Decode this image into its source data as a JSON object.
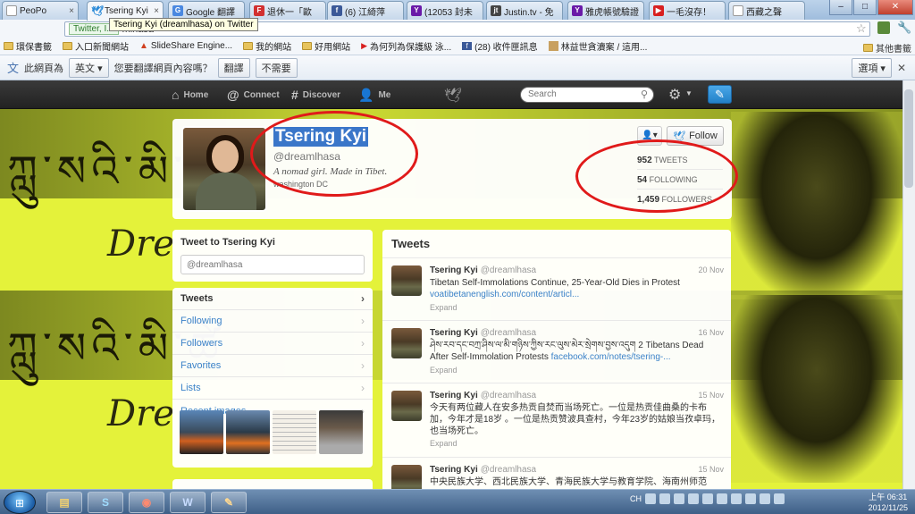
{
  "browser": {
    "tabs": [
      {
        "title": "PeoPo",
        "icon": "document-icon",
        "color": "#ffffff"
      },
      {
        "title": "Tsering Kyi",
        "icon": "twitter-bird-icon",
        "color": "#2a8ad8"
      },
      {
        "title": "Google 翻譯",
        "icon": "google-translate-icon",
        "color": "#4a88e0"
      },
      {
        "title": "退休一「歐",
        "icon": "flipboard-icon",
        "color": "#d23030"
      },
      {
        "title": "(6) 江綺萍",
        "icon": "facebook-icon",
        "color": "#3b5998"
      },
      {
        "title": "(12053 封未",
        "icon": "yahoo-icon",
        "color": "#6a1aa8"
      },
      {
        "title": "Justin.tv - 免",
        "icon": "justintv-icon",
        "color": "#444444"
      },
      {
        "title": "雅虎帳號驗證",
        "icon": "yahoo-icon",
        "color": "#6a1aa8"
      },
      {
        "title": "一毛沒存！",
        "icon": "youtube-icon",
        "color": "#d82020"
      },
      {
        "title": "西藏之聲",
        "icon": "document-icon",
        "color": "#ffffff"
      }
    ],
    "secure_label": "Twitter, I...",
    "url": "mlhasa",
    "tooltip": "Tsering Kyi (dreamlhasa) on Twitter"
  },
  "bookmarks": {
    "items": [
      {
        "label": "環保書籤",
        "icon": "folder-icon"
      },
      {
        "label": "入口新聞網站",
        "icon": "folder-icon"
      },
      {
        "label": "SlideShare Engine...",
        "icon": "slideshare-icon"
      },
      {
        "label": "我的網站",
        "icon": "folder-icon"
      },
      {
        "label": "好用網站",
        "icon": "folder-icon"
      },
      {
        "label": "為何列為保護級 泳...",
        "icon": "youtube-icon"
      },
      {
        "label": "(28) 收件匣訊息",
        "icon": "facebook-icon"
      },
      {
        "label": "林益世貪瀆案 / 這用...",
        "icon": "bookmark-icon"
      }
    ],
    "other": "其他書籤"
  },
  "translate_bar": {
    "prefix": "此網頁為",
    "language": "英文",
    "question": "您要翻譯網頁內容嗎？",
    "translate": "翻譯",
    "no": "不需要",
    "options": "選項"
  },
  "twitter": {
    "nav": {
      "home": "Home",
      "connect": "Connect",
      "discover": "Discover",
      "me": "Me"
    },
    "search_placeholder": "Search",
    "profile": {
      "name": "Tsering Kyi",
      "handle": "@dreamlhasa",
      "bio": "A nomad girl. Made in Tibet.",
      "location": "washington DC",
      "follow": "Follow",
      "stats": [
        {
          "value": "952",
          "label": "TWEETS"
        },
        {
          "value": "54",
          "label": "FOLLOWING"
        },
        {
          "value": "1,459",
          "label": "FOLLOWERS"
        }
      ]
    },
    "tweet_to": {
      "title": "Tweet to Tsering Kyi",
      "placeholder": "@dreamlhasa"
    },
    "menu": [
      "Tweets",
      "Following",
      "Followers",
      "Favorites",
      "Lists",
      "Recent images"
    ],
    "tweets_title": "Tweets",
    "tweets": [
      {
        "name": "Tsering Kyi",
        "handle": "@dreamlhasa",
        "date": "20 Nov",
        "text": "Tibetan Self-Immolations Continue, 25-Year-Old Dies in Protest",
        "link": "voatibetanenglish.com/content/articl...",
        "expand": "Expand"
      },
      {
        "name": "Tsering Kyi",
        "handle": "@dreamlhasa",
        "date": "16 Nov",
        "text": "ཤེས་རབ་དང་བཀྲ་ཤིས་ལ་མི་གཉིས་ཀྱིས་རང་ལུས་མེར་སྲེགས་བྱས་འདུག 2 Tibetans Dead After Self-Immolation Protests",
        "link": "facebook.com/notes/tsering-...",
        "expand": "Expand"
      },
      {
        "name": "Tsering Kyi",
        "handle": "@dreamlhasa",
        "date": "15 Nov",
        "text": "今天有两位藏人在安多热贡自焚而当场死亡。一位是热贡佳曲桑的卡布加，今年才是18岁 。一位是热贡赞波具查村，今年23岁的姑娘当孜卓玛，也当场死亡。",
        "link": "",
        "expand": "Expand"
      },
      {
        "name": "Tsering Kyi",
        "handle": "@dreamlhasa",
        "date": "15 Nov",
        "text": "中央民族大学、西北民族大学、青海民族大学与教育学院、海南州师范",
        "link": "",
        "expand": ""
      }
    ]
  },
  "taskbar": {
    "start": "start-icon",
    "apps": [
      {
        "name": "file-explorer-icon",
        "color": "#e8c050"
      },
      {
        "name": "skype-icon",
        "color": "#1fa8e6"
      },
      {
        "name": "chrome-icon",
        "color": "#e0483a"
      },
      {
        "name": "word-icon",
        "color": "#2a5ba8"
      },
      {
        "name": "paint-icon",
        "color": "#d8a040"
      }
    ],
    "lang": "CH",
    "time": "上午 06:31",
    "date": "2012/11/25"
  },
  "annotations": {
    "ring_color": "#e01a1a"
  },
  "page_background": {
    "script_text": "ཀླུ་སའི་མི་ཚེ",
    "italic_text": "Dre"
  }
}
